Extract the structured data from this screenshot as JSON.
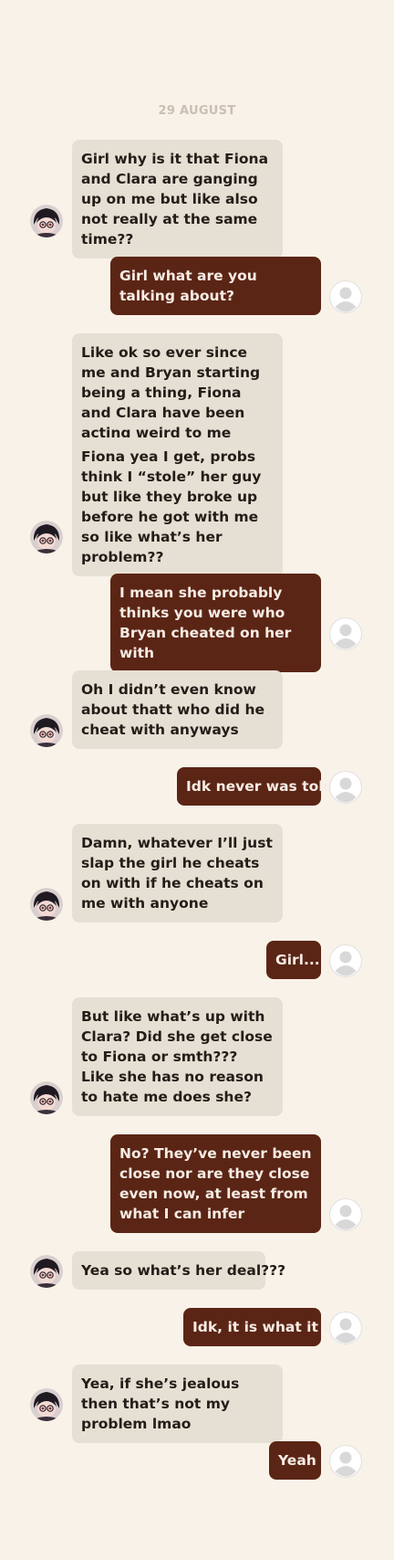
{
  "chat": {
    "date_separator": "29 AUGUST",
    "messages": [
      {
        "sender": "them",
        "text": "Girl why is it that Fiona and Clara are ganging up on me but like also not really at the same time??"
      },
      {
        "sender": "me",
        "text": "Girl what are you talking about?"
      },
      {
        "sender": "them",
        "text": "Like ok so ever since me and Bryan starting being a thing, Fiona and Clara have been acting weird to me"
      },
      {
        "sender": "them",
        "text": "Fiona yea I get, probs think I “stole” her guy but like they broke up before he got with me so like what’s her problem??"
      },
      {
        "sender": "me",
        "text": "I mean she probably thinks you were who Bryan cheated on her with"
      },
      {
        "sender": "them",
        "text": "Oh I didn’t even know about thatt who did he cheat with anyways"
      },
      {
        "sender": "me",
        "text": "Idk never was told"
      },
      {
        "sender": "them",
        "text": "Damn, whatever I’ll just slap the girl he cheats on with if he cheats on me with anyone"
      },
      {
        "sender": "me",
        "text": "Girl..."
      },
      {
        "sender": "them",
        "text": "But like what’s up with Clara? Did she get close to Fiona or smth??? Like she has no reason to hate me does she?"
      },
      {
        "sender": "me",
        "text": " No? They’ve never been close nor are they close even now, at least from what I can infer"
      },
      {
        "sender": "them",
        "text": "Yea so what’s her deal???"
      },
      {
        "sender": "me",
        "text": "Idk, it is what it is"
      },
      {
        "sender": "them",
        "text": "Yea, if she’s jealous then that’s not my problem lmao"
      },
      {
        "sender": "me",
        "text": "Yeah"
      }
    ]
  },
  "avatars": {
    "them": "anime-character-avatar",
    "me": "default-user-avatar"
  },
  "colors": {
    "background": "#f9f2e8",
    "incoming_bubble": "#e6dfd3",
    "outgoing_bubble": "#5b2515",
    "incoming_text": "#231d19",
    "outgoing_text": "#f6ece4",
    "date_text": "#c9bfb2"
  }
}
